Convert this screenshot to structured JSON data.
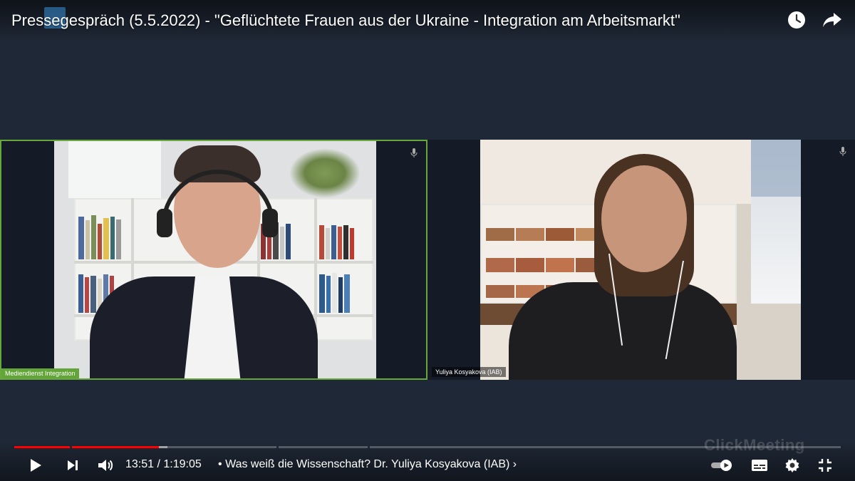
{
  "video": {
    "title": "Pressegespräch (5.5.2022) - \"Geflüchtete Frauen aus der Ukraine - Integration am Arbeitsmarkt\""
  },
  "top_icons": [
    "watch-later-icon",
    "share-icon"
  ],
  "participants": [
    {
      "name": "Mediendienst Integration",
      "active_speaker": true
    },
    {
      "name": "Yuliya Kosyakova (IAB)",
      "active_speaker": false
    }
  ],
  "player": {
    "current_time": "13:51",
    "separator": " / ",
    "duration": "1:19:05",
    "chapter_bullet": "•",
    "chapter": "Was weiß die Wissenschaft? Dr. Yuliya Kosyakova (IAB)",
    "chapter_arrow": "›",
    "progress_fraction": 0.175,
    "buffered_fraction": 0.185
  },
  "watermark": "ClickMeeting",
  "colors": {
    "background": "#1f2836",
    "active_border": "#66a83b",
    "progress": "#ff0000"
  }
}
